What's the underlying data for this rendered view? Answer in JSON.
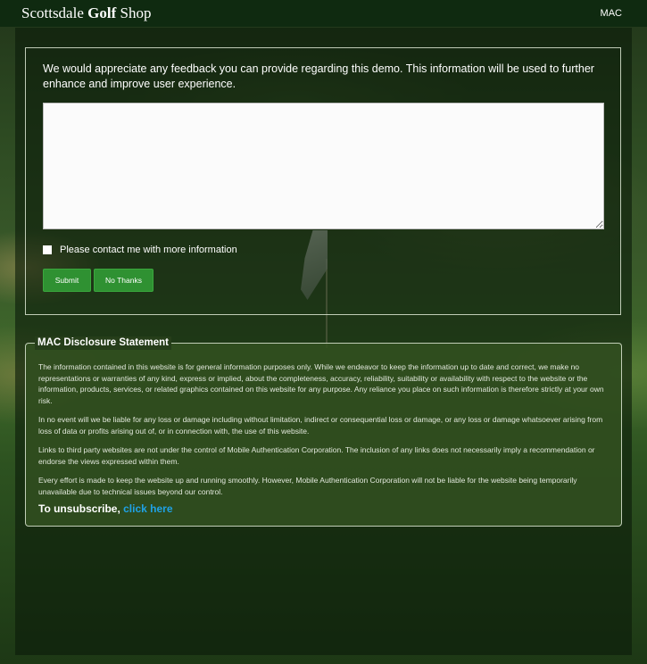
{
  "header": {
    "logo_regular_1": "Scottsdale ",
    "logo_bold": "Golf",
    "logo_regular_2": " Shop",
    "nav_link": "MAC"
  },
  "feedback": {
    "intro": "We would appreciate any feedback you can provide regarding this demo. This information will be used to further enhance and improve user experience.",
    "textarea_value": "",
    "contact_label": "Please contact me with more information",
    "submit_label": "Submit",
    "no_thanks_label": "No Thanks"
  },
  "disclosure": {
    "title": "MAC Disclosure Statement",
    "paragraphs": [
      "The information contained in this website is for general information purposes only. While we endeavor to keep the information up to date and correct, we make no representations or warranties of any kind, express or implied, about the completeness, accuracy, reliability, suitability or availability with respect to the website or the information, products, services, or related graphics contained on this website for any purpose. Any reliance you place on such information is therefore strictly at your own risk.",
      "In no event will we be liable for any loss or damage including without limitation, indirect or consequential loss or damage, or any loss or damage whatsoever arising from loss of data or profits arising out of, or in connection with, the use of this website.",
      "Links to third party websites are not under the control of Mobile Authentication Corporation. The inclusion of any links does not necessarily imply a recommendation or endorse the views expressed within them.",
      "Every effort is made to keep the website up and running smoothly. However, Mobile Authentication Corporation will not be liable for the website being temporarily unavailable due to technical issues beyond our control."
    ],
    "unsubscribe_text": "To unsubscribe, ",
    "unsubscribe_link": "click here"
  },
  "colors": {
    "header_bg": "#0f2a10",
    "button_green": "#2f9132",
    "link_blue": "#1fa2e6"
  }
}
